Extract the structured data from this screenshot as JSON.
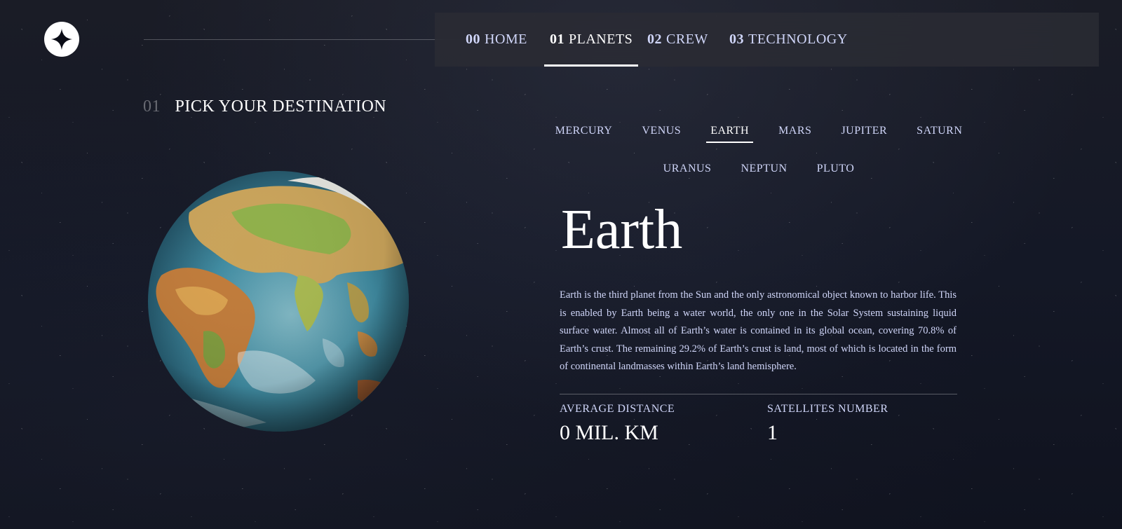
{
  "brand": {
    "logo_icon": "four-point-star-icon"
  },
  "nav": {
    "items": [
      {
        "num": "00",
        "label": "HOME"
      },
      {
        "num": "01",
        "label": "PLANETS"
      },
      {
        "num": "02",
        "label": "CREW"
      },
      {
        "num": "03",
        "label": "TECHNOLOGY"
      }
    ],
    "active": "PLANETS"
  },
  "section": {
    "num": "01",
    "title": "PICK YOUR DESTINATION"
  },
  "planet_tabs": {
    "row1": [
      "MERCURY",
      "VENUS",
      "EARTH",
      "MARS",
      "JUPITER",
      "SATURN"
    ],
    "row2": [
      "URANUS",
      "NEPTUN",
      "PLUTO"
    ],
    "active": "EARTH"
  },
  "planet": {
    "name": "Earth",
    "image_icon": "earth-globe-image",
    "description": "Earth is the third planet from the Sun and the only astronomical object known to harbor life. This is enabled by Earth being a water world, the only one in the Solar System sustaining liquid surface water. Almost all of Earth’s water is contained in its global ocean, covering 70.8% of Earth’s crust. The remaining 29.2% of Earth’s crust is land, most of which is located in the form of continental landmasses within Earth’s land hemisphere.",
    "stats": {
      "distance_label": "AVERAGE DISTANCE",
      "distance_value": "0 MIL. KM",
      "satellites_label": "SATELLITES NUMBER",
      "satellites_value": "1"
    }
  },
  "colors": {
    "background": "#121522",
    "accent_text": "#d0d6f9",
    "white": "#ffffff"
  }
}
